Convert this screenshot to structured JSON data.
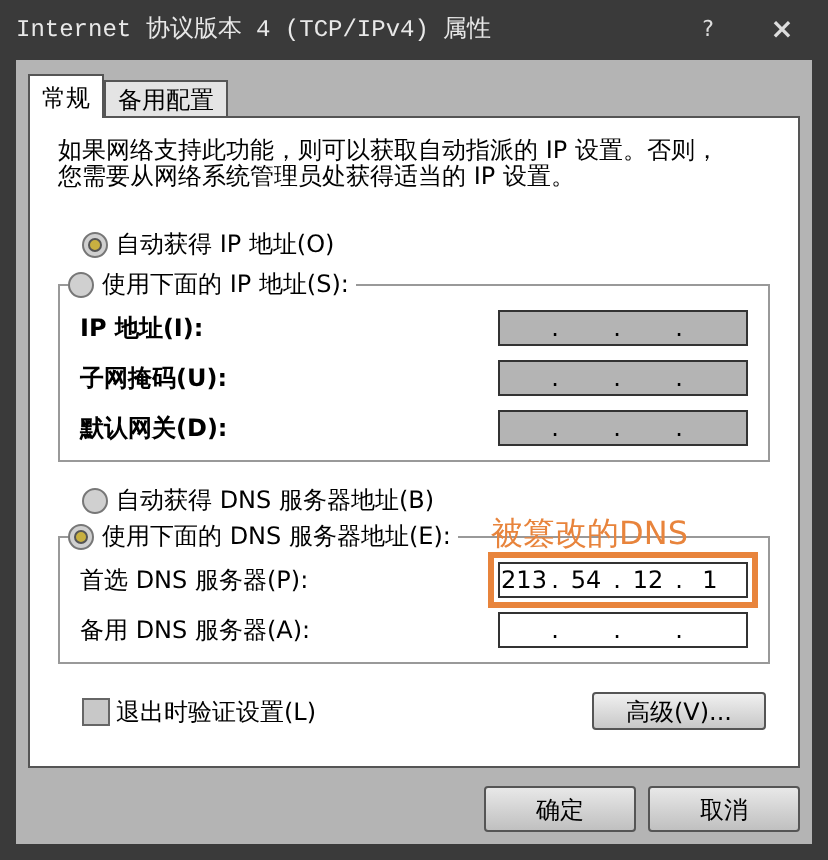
{
  "window": {
    "title": "Internet 协议版本 4 (TCP/IPv4) 属性",
    "help": "?",
    "close": "×"
  },
  "tabs": [
    {
      "label": "常规",
      "selected": true
    },
    {
      "label": "备用配置",
      "selected": false
    }
  ],
  "intro": "如果网络支持此功能，则可以获取自动指派的 IP 设置。否则，您需要从网络系统管理员处获得适当的 IP 设置。",
  "ip": {
    "auto_radio": {
      "label": "自动获得 IP 地址(O)",
      "selected": true
    },
    "manual_radio": {
      "label": "使用下面的 IP 地址(S):",
      "selected": false
    },
    "fields": [
      {
        "label": "IP 地址(I):",
        "disabled": true,
        "separator": "."
      },
      {
        "label": "子网掩码(U):",
        "disabled": true,
        "separator": "."
      },
      {
        "label": "默认网关(D):",
        "disabled": true,
        "separator": "."
      }
    ]
  },
  "dns": {
    "auto_radio": {
      "label": "自动获得 DNS 服务器地址(B)",
      "selected": false
    },
    "manual_radio": {
      "label": "使用下面的 DNS 服务器地址(E):",
      "selected": true
    },
    "annotation": "被篡改的DNS",
    "fields": [
      {
        "label": "首选 DNS 服务器(P):",
        "disabled": false,
        "highlighted": true,
        "separator": ".",
        "octets": [
          "213",
          "54",
          "12",
          "1"
        ]
      },
      {
        "label": "备用 DNS 服务器(A):",
        "disabled": false,
        "highlighted": false,
        "separator": "."
      }
    ]
  },
  "validate_checkbox": {
    "label": "退出时验证设置(L)",
    "checked": false
  },
  "advanced_button": "高级(V)...",
  "buttons": [
    "确定",
    "取消"
  ]
}
